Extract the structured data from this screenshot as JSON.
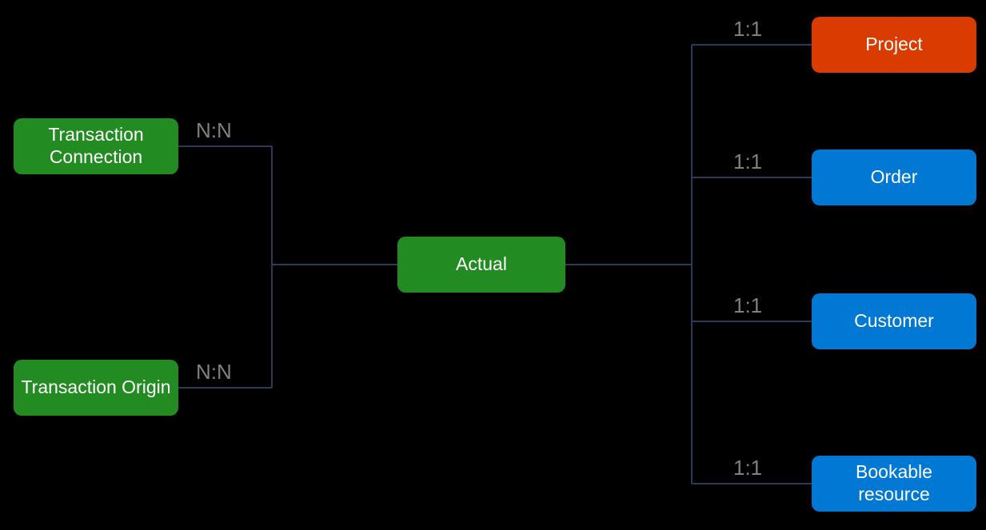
{
  "nodes": {
    "transaction_connection": "Transaction Connection",
    "transaction_origin": "Transaction Origin",
    "actual": "Actual",
    "project": "Project",
    "order": "Order",
    "customer": "Customer",
    "bookable_resource": "Bookable resource"
  },
  "labels": {
    "nn_top": "N:N",
    "nn_bottom": "N:N",
    "one_project": "1:1",
    "one_order": "1:1",
    "one_customer": "1:1",
    "one_bookable": "1:1"
  },
  "colors": {
    "green": "#228c22",
    "red": "#da3b01",
    "blue": "#0078d4",
    "connector": "#2a3a5a",
    "label": "#808080",
    "bg": "#000000"
  }
}
